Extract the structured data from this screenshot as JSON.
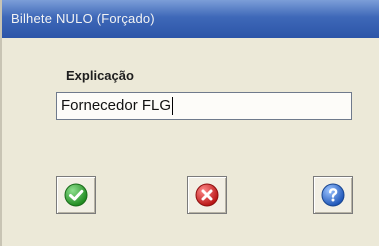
{
  "window": {
    "title": "Bilhete NULO (Forçado)"
  },
  "form": {
    "label": "Explicação",
    "input_value": "Fornecedor FLG"
  },
  "buttons": {
    "ok_icon": "green-check-icon",
    "cancel_icon": "red-x-icon",
    "help_icon": "blue-question-icon"
  },
  "colors": {
    "titlebar": "#3e68b8",
    "ok": "#3aa53a",
    "cancel": "#d12a2a",
    "help": "#2f6fd0"
  }
}
